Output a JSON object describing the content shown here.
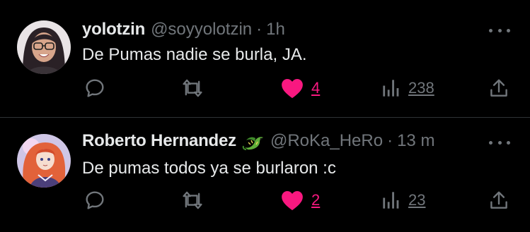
{
  "colors": {
    "background": "#000000",
    "primary_text": "#e7e9ea",
    "secondary_text": "#71767b",
    "like": "#f91880",
    "divider": "#2f3336"
  },
  "tweets": [
    {
      "display_name": "yolotzin",
      "handle": "@soyyolotzin",
      "separator": "·",
      "time": "1h",
      "text": "De Pumas nadie se burla, JA.",
      "avatar_icon": "user-avatar-photo",
      "likes": "4",
      "views": "238",
      "liked": true
    },
    {
      "display_name": "Roberto Hernandez",
      "name_emoji": "dragon-emoji",
      "handle": "@RoKa_HeRo",
      "separator": "·",
      "time": "13 m",
      "text": "De pumas todos ya se burlaron :c",
      "avatar_icon": "anime-character-avatar",
      "likes": "2",
      "views": "23",
      "liked": true
    }
  ]
}
